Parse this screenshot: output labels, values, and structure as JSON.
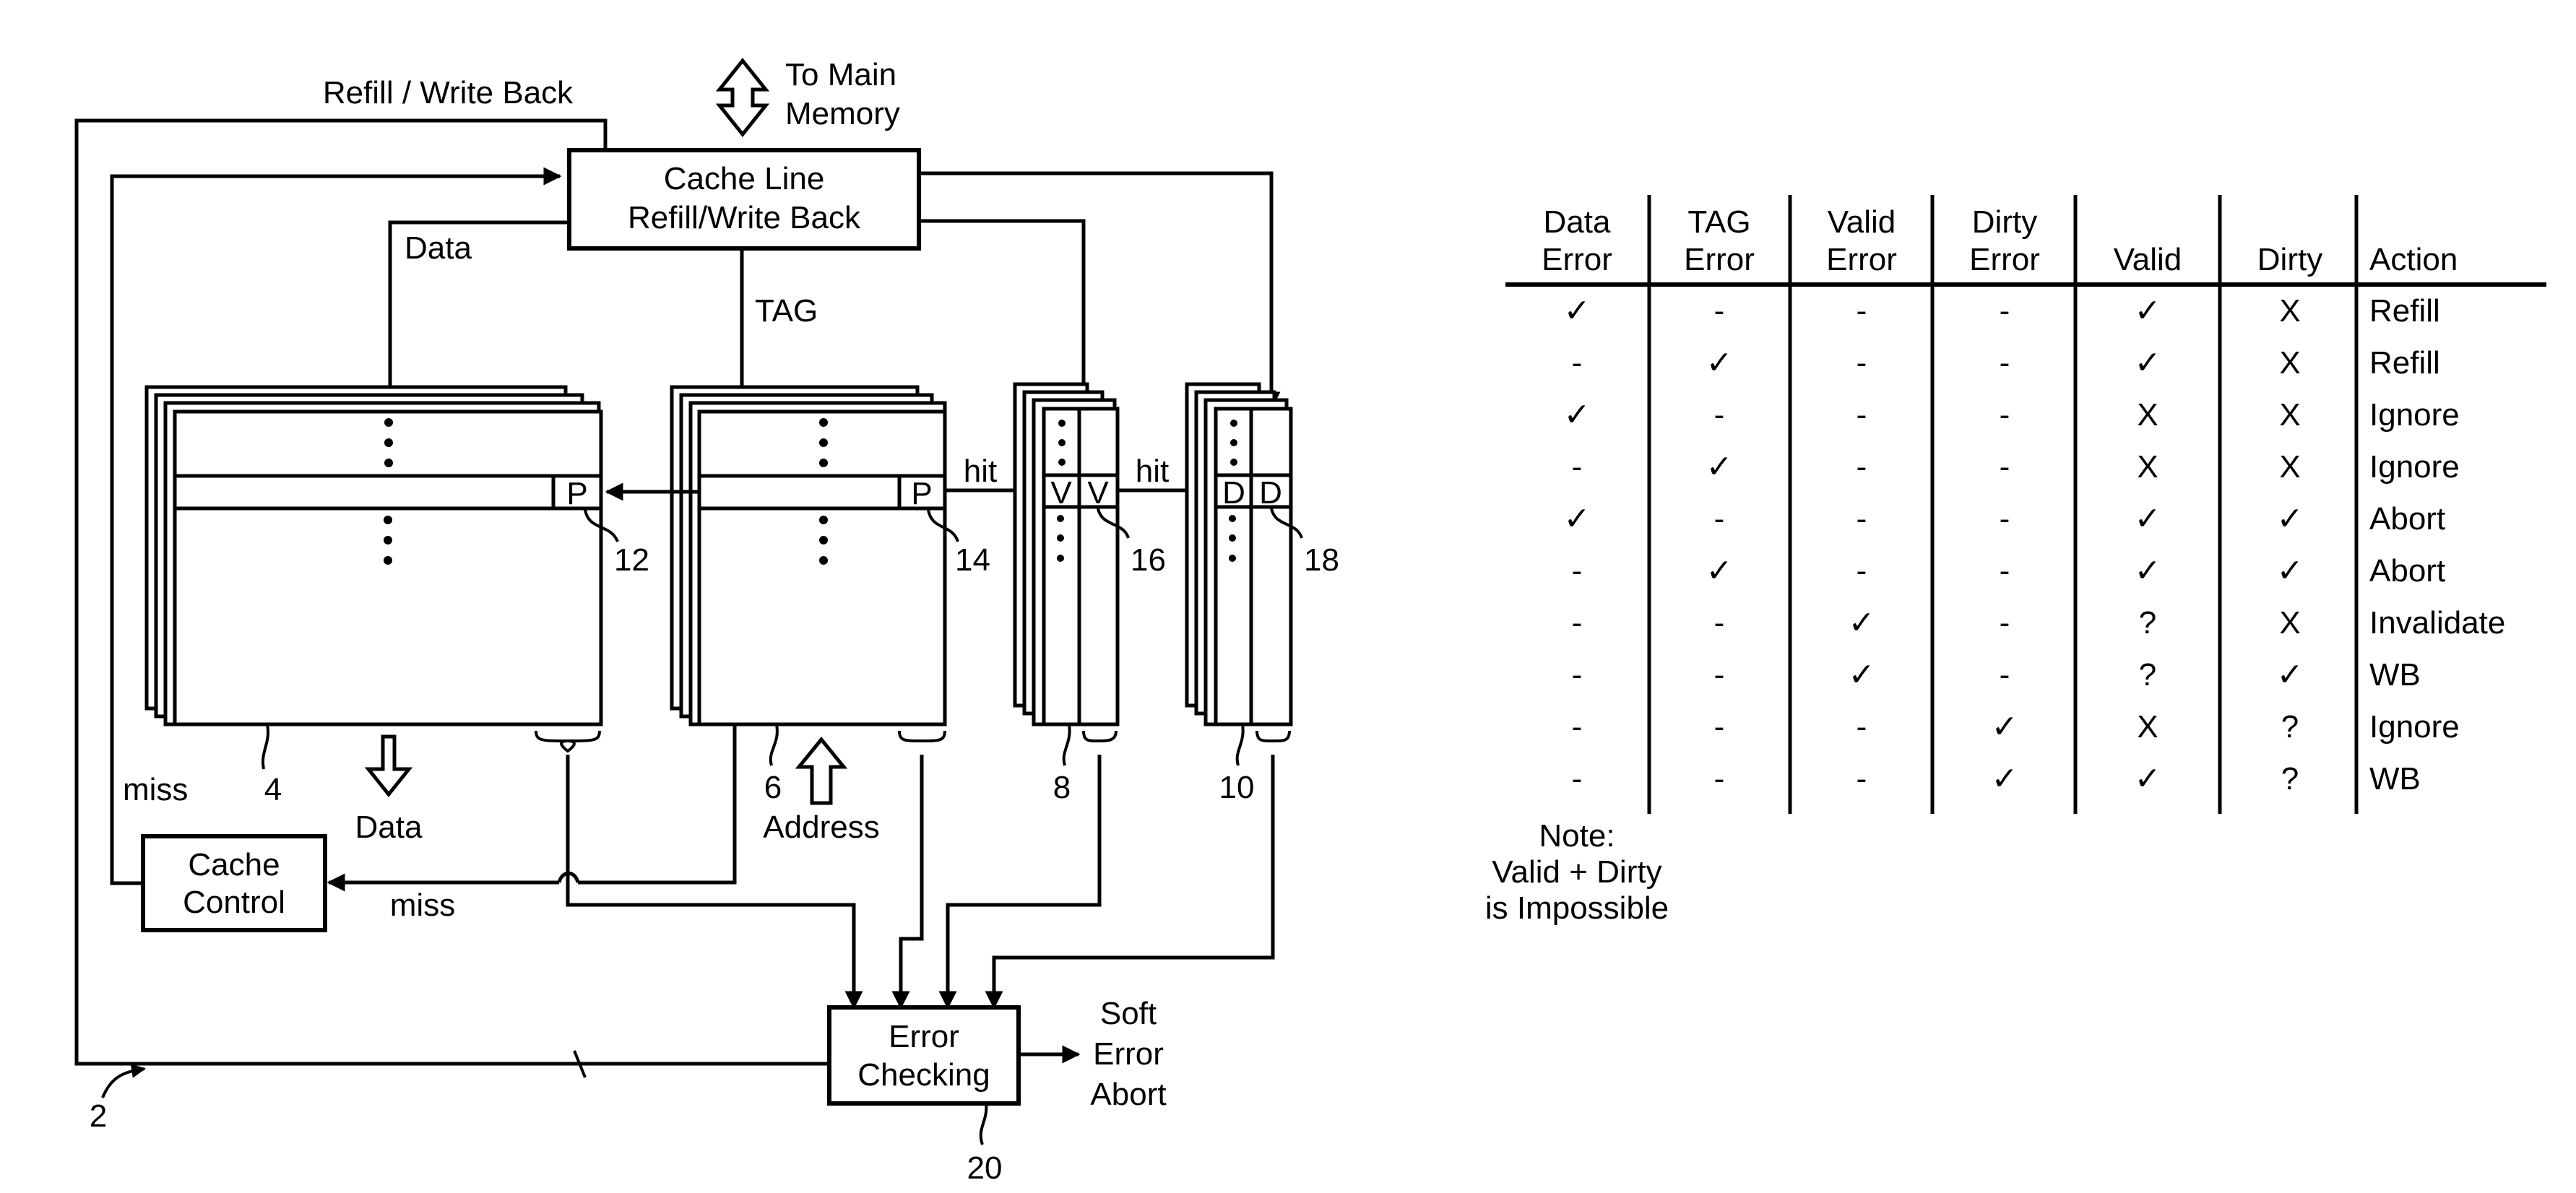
{
  "figure": {
    "reference_number": "2",
    "labels": {
      "refill_write_back": "Refill / Write Back",
      "to_main_memory_line1": "To Main",
      "to_main_memory_line2": "Memory",
      "data_top": "Data",
      "tag": "TAG",
      "hit_1": "hit",
      "hit_2": "hit",
      "miss_left": "miss",
      "miss_bottom": "miss",
      "data_out": "Data",
      "address_in": "Address",
      "soft_error_line1": "Soft",
      "soft_error_line2": "Error",
      "soft_error_line3": "Abort"
    },
    "blocks": {
      "refill_box_line1": "Cache Line",
      "refill_box_line2": "Refill/Write Back",
      "cache_control_line1": "Cache",
      "cache_control_line2": "Control",
      "error_checking_line1": "Error",
      "error_checking_line2": "Checking"
    },
    "cells": {
      "data_parity": "P",
      "tag_parity": "P",
      "valid_a": "V",
      "valid_b": "V",
      "dirty_a": "D",
      "dirty_b": "D"
    },
    "ref_numbers": {
      "data_ram": "4",
      "tag_ram": "6",
      "valid_ram": "8",
      "dirty_ram": "10",
      "data_parity": "12",
      "tag_parity": "14",
      "valid_parity": "16",
      "dirty_parity": "18",
      "error_checking": "20"
    }
  },
  "table": {
    "headers": [
      {
        "line1": "Data",
        "line2": "Error"
      },
      {
        "line1": "TAG",
        "line2": "Error"
      },
      {
        "line1": "Valid",
        "line2": "Error"
      },
      {
        "line1": "Dirty",
        "line2": "Error"
      },
      {
        "line1": "",
        "line2": "Valid"
      },
      {
        "line1": "",
        "line2": "Dirty"
      },
      {
        "line1": "",
        "line2": "Action"
      }
    ],
    "rows": [
      [
        "✓",
        "-",
        "-",
        "-",
        "✓",
        "X",
        "Refill"
      ],
      [
        "-",
        "✓",
        "-",
        "-",
        "✓",
        "X",
        "Refill"
      ],
      [
        "✓",
        "-",
        "-",
        "-",
        "X",
        "X",
        "Ignore"
      ],
      [
        "-",
        "✓",
        "-",
        "-",
        "X",
        "X",
        "Ignore"
      ],
      [
        "✓",
        "-",
        "-",
        "-",
        "✓",
        "✓",
        "Abort"
      ],
      [
        "-",
        "✓",
        "-",
        "-",
        "✓",
        "✓",
        "Abort"
      ],
      [
        "-",
        "-",
        "✓",
        "-",
        "?",
        "X",
        "Invalidate"
      ],
      [
        "-",
        "-",
        "✓",
        "-",
        "?",
        "✓",
        "WB"
      ],
      [
        "-",
        "-",
        "-",
        "✓",
        "X",
        "?",
        "Ignore"
      ],
      [
        "-",
        "-",
        "-",
        "✓",
        "✓",
        "?",
        "WB"
      ]
    ],
    "note": [
      "Note:",
      "Valid + Dirty",
      "is Impossible"
    ]
  }
}
